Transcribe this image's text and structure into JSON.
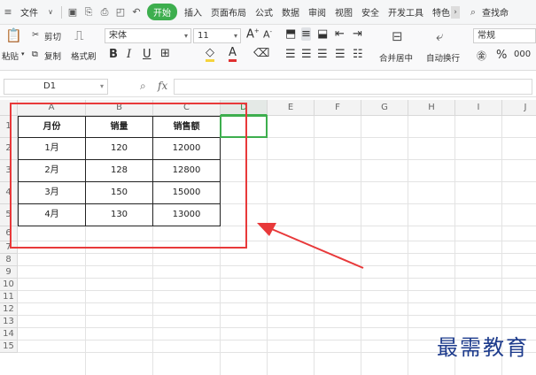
{
  "menubar": {
    "file_menu": "文件",
    "tabs": [
      "开始",
      "插入",
      "页面布局",
      "公式",
      "数据",
      "审阅",
      "视图",
      "安全",
      "开发工具",
      "特色"
    ],
    "active_tab": "开始",
    "search": "查找命"
  },
  "ribbon": {
    "paste": "粘贴",
    "cut": "剪切",
    "copy": "复制",
    "format_painter": "格式刷",
    "font_name": "宋体",
    "font_size": "11",
    "merge_center": "合并居中",
    "wrap_text": "自动换行",
    "number_format": "常规"
  },
  "formula_bar": {
    "cell_ref": "D1",
    "fx": "fx",
    "formula": ""
  },
  "columns": [
    "A",
    "B",
    "C",
    "D",
    "E",
    "F",
    "G",
    "H",
    "I",
    "J"
  ],
  "active_column": "D",
  "rows": [
    "1",
    "2",
    "3",
    "4",
    "5",
    "6",
    "7",
    "8",
    "9",
    "10",
    "11",
    "12",
    "13",
    "14",
    "15"
  ],
  "table": {
    "headers": [
      "月份",
      "销量",
      "销售额"
    ],
    "rows": [
      [
        "1月",
        "120",
        "12000"
      ],
      [
        "2月",
        "128",
        "12800"
      ],
      [
        "3月",
        "150",
        "15000"
      ],
      [
        "4月",
        "130",
        "13000"
      ]
    ]
  },
  "annotation_color": "#e8393a",
  "accent_color": "#3dae4e",
  "watermark": "最需教育"
}
